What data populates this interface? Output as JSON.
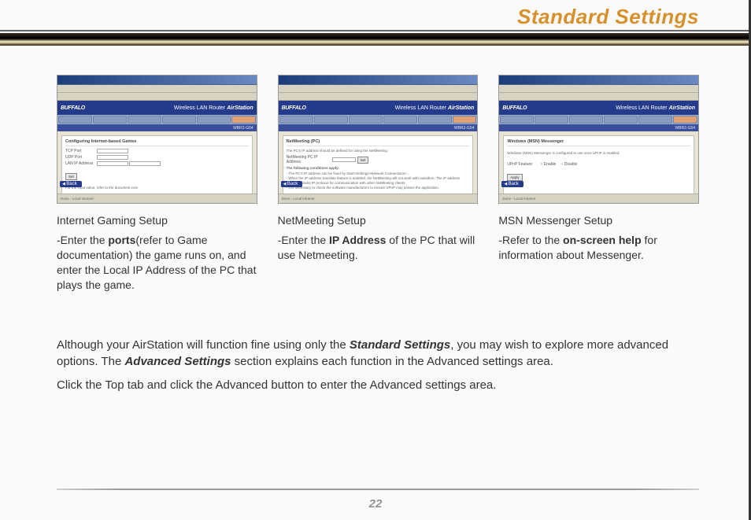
{
  "header": {
    "title": "Standard Settings"
  },
  "thumbs": {
    "brand_left": "BUFFALO",
    "brand_right_prefix": "Wireless LAN Router",
    "brand_right_logo": "AirStation",
    "model": "WBR2-G54",
    "back_label": "Back",
    "status_text": "Done  -  Local intranet"
  },
  "panes": {
    "gaming_hdr": "Configuring Internet-based Games",
    "gaming_tcp": "TCP Port",
    "gaming_udp": "UDP Port",
    "gaming_ip": "LAN IP Address",
    "gaming_set": "Set",
    "gaming_note": "For the input value, refer to the document.com",
    "net_hdr": "NetMeeting (PC)",
    "net_line1": "The PC's IP address should be defined for using the NetMeeting.",
    "net_field": "NetMeeting PC IP Address",
    "net_set": "Set",
    "net_cond_hdr": "The following conditions apply:",
    "net_cond_body": "- The PC's IP address can be fixed by Start>Settings>Network Connections>...\n- When the IP address translate feature is enabled, the NetMeeting will not work with outsiders. The IP address translate grants IP protocol for communication with other NetMeeting clients.\n- It is necessary to check the software manufacturers to ensure UPnP may protect the application.",
    "msn_hdr": "Windows (MSN) Messenger",
    "msn_body": "Windows (MSN) Messenger is configured to use once UPnP is enabled.",
    "msn_opt_label": "UPnP Feature:",
    "msn_opt_enable": "Enable",
    "msn_opt_disable": "Disable",
    "msn_apply": "Apply"
  },
  "columns": {
    "c1": {
      "heading": "Internet Gaming Setup",
      "t1": "-Enter the ",
      "b1": "ports",
      "t2": "(refer to Game documentation) the game runs on, and enter the Local IP Address of the PC that plays the game."
    },
    "c2": {
      "heading": "NetMeeting Setup",
      "t1": "-Enter the ",
      "b1": "IP Address",
      "t2": " of the PC that will use Netmeeting."
    },
    "c3": {
      "heading": "MSN Messenger Setup",
      "t1": "-Refer to the ",
      "b1": "on-screen help",
      "t2": " for information about Messenger."
    }
  },
  "footer": {
    "p1a": "Although your AirStation will function fine using only the ",
    "p1b": "Standard Settings",
    "p1c": ", you may wish to explore more advanced options.  The ",
    "p1d": "Advanced Settings",
    "p1e": " section explains each function in the Advanced settings area.",
    "p2": "Click the Top tab and click the Advanced button to enter the Advanced settings area."
  },
  "page_number": "22"
}
